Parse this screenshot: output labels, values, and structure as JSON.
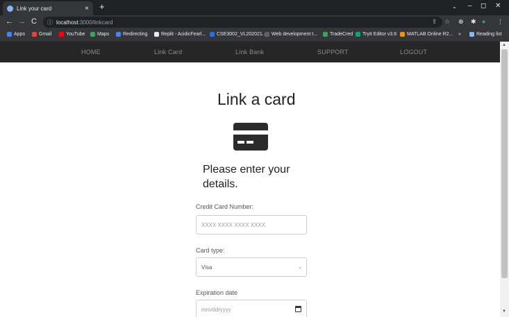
{
  "browser": {
    "tab_title": "Link your card",
    "tab_close": "×",
    "new_tab": "+",
    "window_controls": {
      "dropdown": "⌄",
      "minimize": "–",
      "maximize": "◻",
      "close": "✕"
    },
    "nav": {
      "back": "←",
      "forward": "→",
      "reload": "C"
    },
    "address": {
      "info": "ⓘ",
      "host": "localhost",
      "path": ":3000/linkcard"
    },
    "extensions": [
      "⊕",
      "✱",
      "●",
      "⋮"
    ],
    "bookmarks": [
      {
        "label": "Apps",
        "color": "#4285f4"
      },
      {
        "label": "Gmail",
        "color": "#ea4335"
      },
      {
        "label": "YouTube",
        "color": "#ff0000"
      },
      {
        "label": "Maps",
        "color": "#34a853"
      },
      {
        "label": "Redirecting",
        "color": "#4285f4"
      },
      {
        "label": "Replit - AcidicFearl...",
        "color": "#e8eaed"
      },
      {
        "label": "CSE3002_VL202021...",
        "color": "#1a73e8"
      },
      {
        "label": "Web development t...",
        "color": "#5f6368"
      },
      {
        "label": "TradeCred",
        "color": "#34a853"
      },
      {
        "label": "TryIt Editor v3.6",
        "color": "#04aa6d"
      },
      {
        "label": "MATLAB Online R2...",
        "color": "#f29111"
      },
      {
        "label": "»",
        "color": ""
      },
      {
        "label": "Reading list",
        "color": "#8ab4f8"
      }
    ]
  },
  "site_nav": {
    "items": [
      "HOME",
      "Link Card",
      "Link Bank",
      "SUPPORT",
      "LOGOUT"
    ]
  },
  "form": {
    "title": "Link a card",
    "subtitle": "Please enter your details.",
    "card_number_label": "Credit Card Number:",
    "card_number_placeholder": "XXXX XXXX XXXX XXXX",
    "card_type_label": "Card type:",
    "card_type_value": "Visa",
    "expiration_label": "Expiration date",
    "expiration_placeholder": "mm/dd/yyyy"
  },
  "colors": {
    "nav_bg": "#262626",
    "nav_text": "#8c8c8c",
    "icon_dark": "#2b2b2b"
  }
}
